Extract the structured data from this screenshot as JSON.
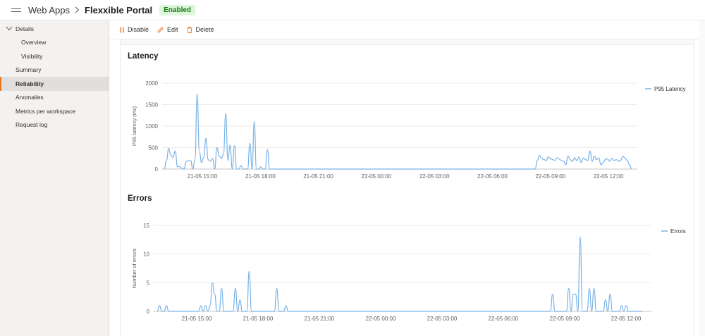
{
  "header": {
    "breadcrumb": "Web Apps",
    "title": "Flexxible Portal",
    "status_badge": "Enabled"
  },
  "sidebar": {
    "items": [
      {
        "label": "Details",
        "level": "group"
      },
      {
        "label": "Overview",
        "level": "child"
      },
      {
        "label": "Visibility",
        "level": "child"
      },
      {
        "label": "Summary",
        "level": "top"
      },
      {
        "label": "Reliability",
        "level": "top",
        "active": true
      },
      {
        "label": "Anomalies",
        "level": "top"
      },
      {
        "label": "Metrics per workspace",
        "level": "top"
      },
      {
        "label": "Request log",
        "level": "top"
      }
    ]
  },
  "toolbar": {
    "disable_label": "Disable",
    "edit_label": "Edit",
    "delete_label": "Delete"
  },
  "colors": {
    "series": "#78b2e6",
    "accent": "#e97424",
    "enabled_bg": "#dff6dd",
    "enabled_fg": "#107c10"
  },
  "sections": {
    "latency_title": "Latency",
    "errors_title": "Errors"
  },
  "chart_data": [
    {
      "type": "line",
      "title": "Latency",
      "ylabel": "P95 latency (ms)",
      "xlabel": "",
      "ylim": [
        0,
        2000
      ],
      "yticks": [
        0,
        500,
        1000,
        1500,
        2000
      ],
      "grid": true,
      "legend": "top-right",
      "series": [
        {
          "name": "P95 Latency",
          "values": [
            0,
            200,
            480,
            320,
            270,
            420,
            50,
            60,
            20,
            0,
            180,
            190,
            200,
            0,
            230,
            1750,
            400,
            150,
            280,
            720,
            220,
            180,
            250,
            0,
            500,
            300,
            250,
            350,
            1300,
            200,
            560,
            0,
            550,
            0,
            0,
            80,
            0,
            0,
            0,
            600,
            0,
            1100,
            0,
            0,
            50,
            0,
            0,
            450,
            0,
            0,
            0,
            0,
            0,
            0,
            0,
            0,
            0,
            0,
            0,
            0,
            0,
            0,
            0,
            0,
            0,
            0,
            0,
            0,
            0,
            0,
            0,
            0,
            0,
            0,
            0,
            0,
            0,
            0,
            0,
            0,
            0,
            0,
            0,
            0,
            0,
            0,
            0,
            0,
            0,
            0,
            0,
            0,
            0,
            0,
            0,
            0,
            0,
            0,
            0,
            0,
            0,
            0,
            0,
            0,
            0,
            0,
            0,
            0,
            0,
            0,
            0,
            0,
            0,
            0,
            0,
            0,
            0,
            0,
            0,
            0,
            0,
            0,
            0,
            0,
            0,
            0,
            0,
            0,
            0,
            0,
            0,
            0,
            0,
            0,
            0,
            0,
            0,
            0,
            0,
            0,
            0,
            0,
            0,
            0,
            0,
            0,
            0,
            0,
            0,
            0,
            0,
            0,
            0,
            0,
            0,
            0,
            0,
            0,
            0,
            0,
            0,
            0,
            0,
            0,
            0,
            0,
            0,
            0,
            0,
            0,
            200,
            320,
            250,
            220,
            200,
            280,
            240,
            220,
            200,
            260,
            230,
            200,
            180,
            100,
            300,
            220,
            180,
            260,
            200,
            280,
            150,
            260,
            220,
            200,
            420,
            180,
            300,
            220,
            260,
            100,
            150,
            220,
            240,
            180,
            250,
            200,
            220,
            180,
            200,
            300,
            250,
            200,
            100,
            0
          ]
        }
      ],
      "xticks": [
        "21-05 15:00",
        "21-05 18:00",
        "21-05 21:00",
        "22-05 00:00",
        "22-05 03:00",
        "22-05 06:00",
        "22-05 09:00",
        "22-05 12:00"
      ]
    },
    {
      "type": "line",
      "title": "Errors",
      "ylabel": "Number of errors",
      "xlabel": "",
      "ylim": [
        0,
        15
      ],
      "yticks": [
        0,
        5,
        10,
        15
      ],
      "grid": true,
      "legend": "top-right",
      "series": [
        {
          "name": "Errors",
          "values": [
            0,
            1,
            0,
            0,
            1,
            0,
            0,
            0,
            0,
            0,
            0,
            0,
            0,
            0,
            0,
            0,
            0,
            0,
            0,
            1,
            0,
            1,
            0,
            1,
            5,
            3,
            0,
            0,
            4,
            0,
            0,
            0,
            0,
            0,
            4,
            0,
            2,
            0,
            0,
            0,
            7,
            0,
            0,
            0,
            0,
            0,
            0,
            0,
            0,
            0,
            0,
            0,
            4,
            0,
            0,
            0,
            1,
            0,
            0,
            0,
            0,
            0,
            0,
            0,
            0,
            0,
            0,
            0,
            0,
            0,
            0,
            0,
            0,
            0,
            0,
            0,
            0,
            0,
            0,
            0,
            0,
            0,
            0,
            0,
            0,
            0,
            0,
            0,
            0,
            0,
            0,
            0,
            0,
            0,
            0,
            0,
            0,
            0,
            0,
            0,
            0,
            0,
            0,
            0,
            0,
            0,
            0,
            0,
            0,
            0,
            0,
            0,
            0,
            0,
            0,
            0,
            0,
            0,
            0,
            0,
            0,
            0,
            0,
            0,
            0,
            0,
            0,
            0,
            0,
            0,
            0,
            0,
            0,
            0,
            0,
            0,
            0,
            0,
            0,
            0,
            0,
            0,
            0,
            0,
            0,
            0,
            0,
            0,
            0,
            0,
            0,
            0,
            0,
            0,
            0,
            0,
            0,
            0,
            0,
            0,
            0,
            0,
            0,
            0,
            0,
            0,
            0,
            0,
            0,
            0,
            0,
            0,
            3,
            0,
            0,
            0,
            0,
            0,
            0,
            4,
            0,
            3,
            3,
            0,
            13,
            0,
            0,
            0,
            4,
            0,
            4,
            0,
            0,
            0,
            0,
            2,
            0,
            3,
            0,
            0,
            0,
            0,
            1,
            0,
            1,
            0,
            0,
            0,
            0,
            0,
            0,
            0
          ]
        }
      ],
      "xticks": [
        "21-05 15:00",
        "21-05 18:00",
        "21-05 21:00",
        "22-05 00:00",
        "22-05 03:00",
        "22-05 06:00",
        "22-05 09:00",
        "22-05 12:00"
      ]
    }
  ]
}
